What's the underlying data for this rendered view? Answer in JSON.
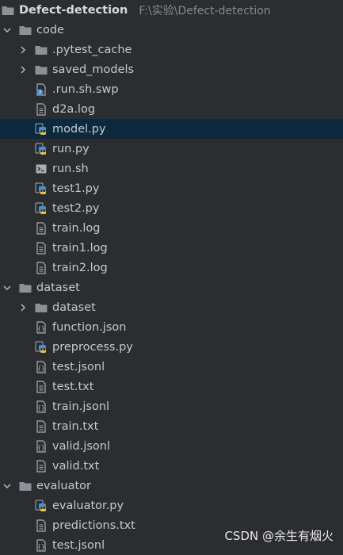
{
  "project": {
    "name": "Defect-detection",
    "path": "F:\\实验\\Defect-detection"
  },
  "colors": {
    "background": "#2b2d30",
    "selection": "#0d293e",
    "text": "#c5c9d0",
    "folder": "#8c9097",
    "python_blue": "#4a8fd4",
    "python_yellow": "#f0c23b"
  },
  "tree": [
    {
      "label": "code",
      "type": "folder",
      "level": 1,
      "expanded": true
    },
    {
      "label": ".pytest_cache",
      "type": "folder",
      "level": 2,
      "expanded": false
    },
    {
      "label": "saved_models",
      "type": "folder",
      "level": 2,
      "expanded": false
    },
    {
      "label": ".run.sh.swp",
      "type": "unknown",
      "level": 2
    },
    {
      "label": "d2a.log",
      "type": "text",
      "level": 2
    },
    {
      "label": "model.py",
      "type": "python",
      "level": 2,
      "selected": true
    },
    {
      "label": "run.py",
      "type": "python",
      "level": 2
    },
    {
      "label": "run.sh",
      "type": "shell",
      "level": 2
    },
    {
      "label": "test1.py",
      "type": "python",
      "level": 2
    },
    {
      "label": "test2.py",
      "type": "python",
      "level": 2
    },
    {
      "label": "train.log",
      "type": "text",
      "level": 2
    },
    {
      "label": "train1.log",
      "type": "text",
      "level": 2
    },
    {
      "label": "train2.log",
      "type": "text",
      "level": 2
    },
    {
      "label": "dataset",
      "type": "folder",
      "level": 1,
      "expanded": true
    },
    {
      "label": "dataset",
      "type": "folder",
      "level": 2,
      "expanded": false
    },
    {
      "label": "function.json",
      "type": "json",
      "level": 2
    },
    {
      "label": "preprocess.py",
      "type": "python",
      "level": 2
    },
    {
      "label": "test.jsonl",
      "type": "json",
      "level": 2
    },
    {
      "label": "test.txt",
      "type": "text",
      "level": 2
    },
    {
      "label": "train.jsonl",
      "type": "json",
      "level": 2
    },
    {
      "label": "train.txt",
      "type": "text",
      "level": 2
    },
    {
      "label": "valid.jsonl",
      "type": "json",
      "level": 2
    },
    {
      "label": "valid.txt",
      "type": "text",
      "level": 2
    },
    {
      "label": "evaluator",
      "type": "folder",
      "level": 1,
      "expanded": true
    },
    {
      "label": "evaluator.py",
      "type": "python",
      "level": 2
    },
    {
      "label": "predictions.txt",
      "type": "text",
      "level": 2
    },
    {
      "label": "test.jsonl",
      "type": "json",
      "level": 2
    }
  ],
  "watermark": "CSDN @余生有烟火"
}
